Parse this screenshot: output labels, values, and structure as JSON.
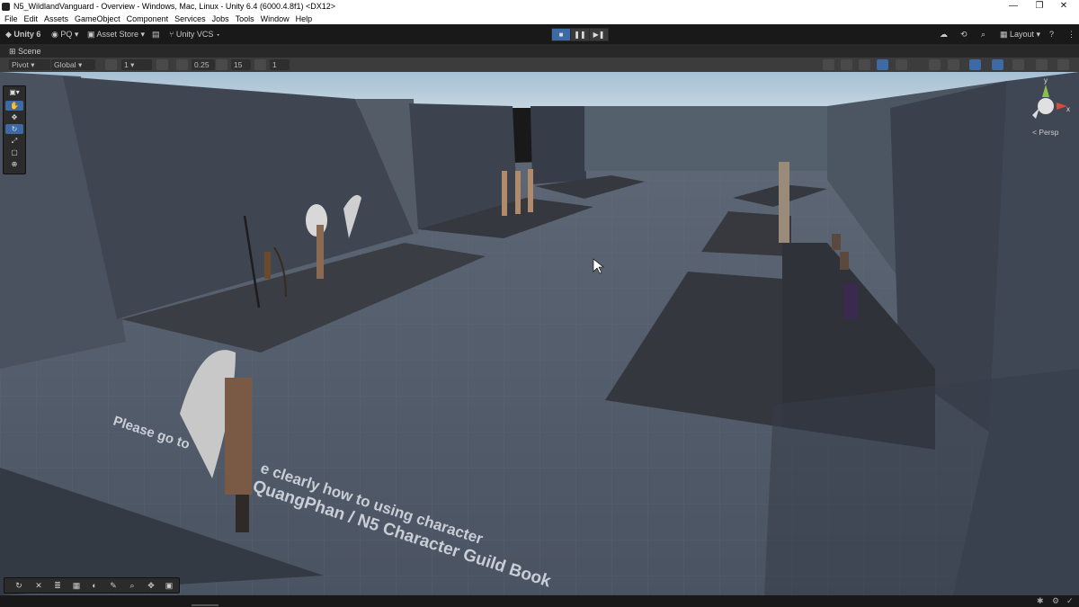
{
  "window": {
    "title": "N5_WildlandVanguard - Overview - Windows, Mac, Linux - Unity 6.4 (6000.4.8f1) <DX12>",
    "minimize": "—",
    "maximize": "❐",
    "close": "✕"
  },
  "menu": [
    "File",
    "Edit",
    "Assets",
    "GameObject",
    "Component",
    "Services",
    "Jobs",
    "Tools",
    "Window",
    "Help"
  ],
  "toolbar": {
    "unity_label": "Unity 6",
    "account_label": "PQ",
    "asset_store_label": "Asset Store",
    "vcs_label": "Unity VCS",
    "layout_label": "Layout",
    "play_icon": "■",
    "pause_icon": "❚❚",
    "step_icon": "▶❚"
  },
  "scene_tab": {
    "label": "Scene"
  },
  "scene_toolbar": {
    "pivot_label": "Pivot",
    "global_label": "Global",
    "grid_value": "1",
    "snap_value": "0.25",
    "angle_value": "15",
    "scale_value": "1"
  },
  "scene": {
    "floor_text_line1": "Please go to ... e clearly how to using character",
    "floor_text_line2": "QuangPhan / N5 Character Guild Book",
    "floor_text_visible_a": "Please go to",
    "floor_text_visible_b": "e clearly how to using character",
    "floor_text_visible_c": "QuangPhan / N5 Character Guild Book",
    "gizmo_label": "< Persp",
    "gizmo_axes": [
      "y",
      "x"
    ],
    "colors": {
      "sky": "#a9c3d6",
      "floor": "#4a5260",
      "wall": "#3b4350",
      "platform": "#3a3d43",
      "accent": "#3d6aa5"
    }
  }
}
